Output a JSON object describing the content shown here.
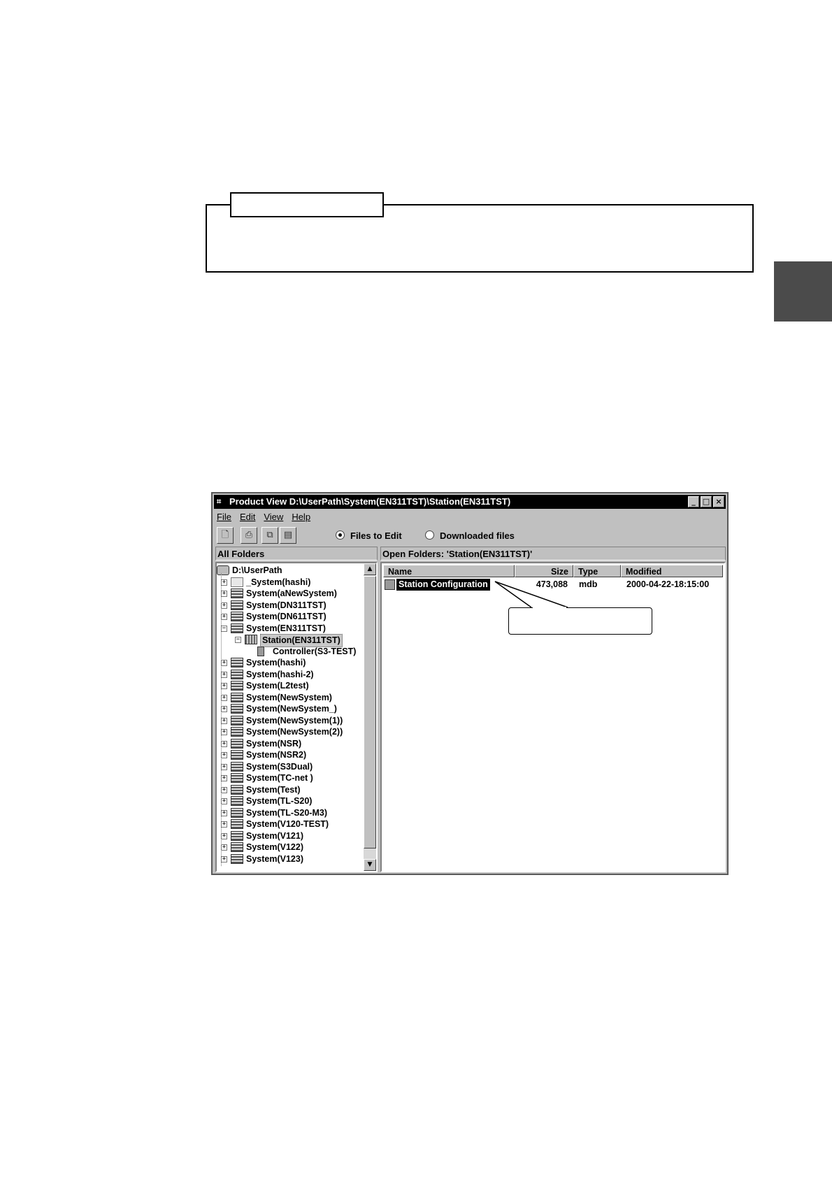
{
  "window": {
    "title": "Product View  D:\\UserPath\\System(EN311TST)\\Station(EN311TST)",
    "controls": [
      "_",
      "□",
      "×"
    ]
  },
  "menu": [
    "File",
    "Edit",
    "View",
    "Help"
  ],
  "toolbar": {
    "radio_files_to_edit": "Files to Edit",
    "radio_downloaded": "Downloaded files",
    "selected": "Files to Edit"
  },
  "left_panel": {
    "header": "All Folders",
    "tree": [
      "D:\\UserPath",
      "_System(hashi)",
      "System(aNewSystem)",
      "System(DN311TST)",
      "System(DN611TST)",
      "System(EN311TST)",
      "Station(EN311TST)",
      "Controller(S3-TEST)",
      "System(hashi)",
      "System(hashi-2)",
      "System(L2test)",
      "System(NewSystem)",
      "System(NewSystem_)",
      "System(NewSystem(1))",
      "System(NewSystem(2))",
      "System(NSR)",
      "System(NSR2)",
      "System(S3Dual)",
      "System(TC-net )",
      "System(Test)",
      "System(TL-S20)",
      "System(TL-S20-M3)",
      "System(V120-TEST)",
      "System(V121)",
      "System(V122)",
      "System(V123)"
    ]
  },
  "right_panel": {
    "header": "Open Folders: 'Station(EN311TST)'",
    "columns": [
      "Name",
      "Size",
      "Type",
      "Modified"
    ],
    "rows": [
      {
        "name": "Station Configuration",
        "size": "473,088",
        "type": "mdb",
        "modified": "2000-04-22-18:15:00"
      }
    ]
  },
  "colors": {
    "titlebar": "#000000",
    "window_face": "#c0c0c0",
    "side_tab": "#4b4b4b"
  }
}
